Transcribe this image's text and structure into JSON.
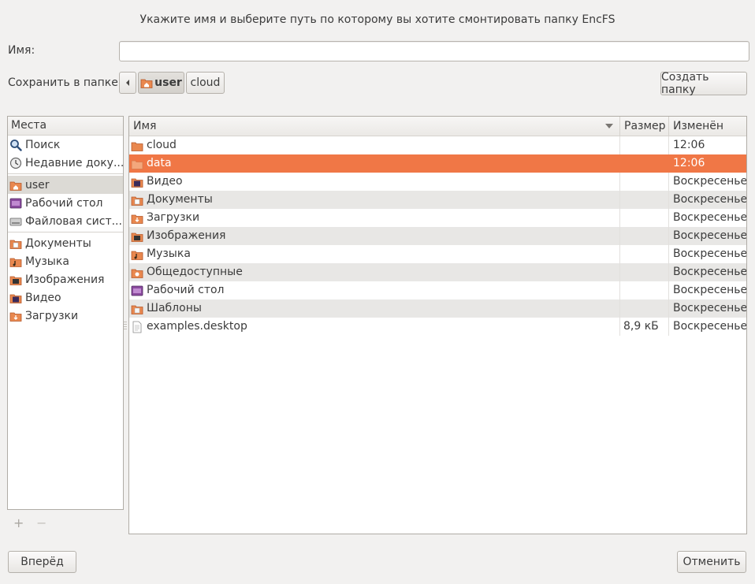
{
  "dialog": {
    "title": "Укажите имя и выберите путь по которому вы хотите смонтировать папку EncFS",
    "name_label": "Имя:",
    "name_value": "",
    "save_label": "Сохранить в папке",
    "create_folder": "Создать папку",
    "forward": "Вперёд",
    "cancel": "Отменить"
  },
  "path": {
    "segments": [
      "user",
      "cloud"
    ]
  },
  "places": {
    "header": "Места",
    "items": [
      {
        "label": "Поиск",
        "icon": "search-icon"
      },
      {
        "label": "Недавние доку...",
        "icon": "recent-icon"
      },
      {
        "label": "user",
        "icon": "home-folder-icon"
      },
      {
        "label": "Рабочий стол",
        "icon": "desktop-icon"
      },
      {
        "label": "Файловая сист...",
        "icon": "drive-icon"
      },
      {
        "label": "Документы",
        "icon": "documents-folder-icon"
      },
      {
        "label": "Музыка",
        "icon": "music-folder-icon"
      },
      {
        "label": "Изображения",
        "icon": "pictures-folder-icon"
      },
      {
        "label": "Видео",
        "icon": "video-folder-icon"
      },
      {
        "label": "Загрузки",
        "icon": "downloads-folder-icon"
      }
    ],
    "add": "+",
    "remove": "−"
  },
  "files": {
    "columns": {
      "name": "Имя",
      "size": "Размер",
      "modified": "Изменён"
    },
    "rows": [
      {
        "name": "cloud",
        "size": "",
        "modified": "12:06",
        "icon": "folder-icon"
      },
      {
        "name": "data",
        "size": "",
        "modified": "12:06",
        "icon": "folder-icon"
      },
      {
        "name": "Видео",
        "size": "",
        "modified": "Воскресенье",
        "icon": "video-folder-icon"
      },
      {
        "name": "Документы",
        "size": "",
        "modified": "Воскресенье",
        "icon": "documents-folder-icon"
      },
      {
        "name": "Загрузки",
        "size": "",
        "modified": "Воскресенье",
        "icon": "downloads-folder-icon"
      },
      {
        "name": "Изображения",
        "size": "",
        "modified": "Воскресенье",
        "icon": "pictures-folder-icon"
      },
      {
        "name": "Музыка",
        "size": "",
        "modified": "Воскресенье",
        "icon": "music-folder-icon"
      },
      {
        "name": "Общедоступные",
        "size": "",
        "modified": "Воскресенье",
        "icon": "public-folder-icon"
      },
      {
        "name": "Рабочий стол",
        "size": "",
        "modified": "Воскресенье",
        "icon": "desktop-icon"
      },
      {
        "name": "Шаблоны",
        "size": "",
        "modified": "Воскресенье",
        "icon": "templates-folder-icon"
      },
      {
        "name": "examples.desktop",
        "size": "8,9 кБ",
        "modified": "Воскресенье",
        "icon": "file-icon"
      }
    ]
  },
  "colors": {
    "selection": "#f07746",
    "folder": "#e9884f",
    "background": "#f2f1f0"
  }
}
